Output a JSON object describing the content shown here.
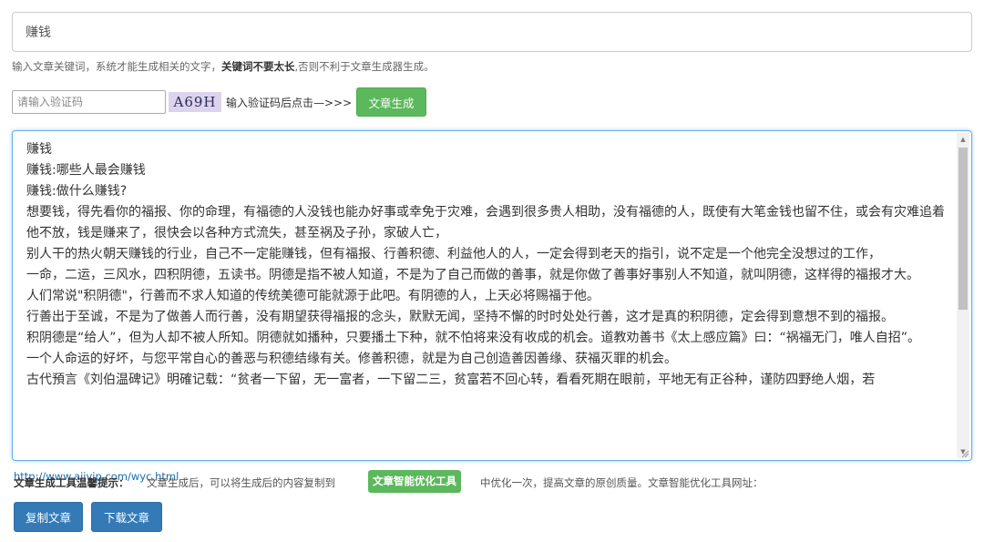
{
  "keyword": {
    "value": "赚钱"
  },
  "hint": {
    "prefix": "输入文章关键词，系统才能生成相关的文字，",
    "bold": "关键词不要太长",
    "suffix": ",否则不利于文章生成器生成。"
  },
  "captcha": {
    "placeholder": "请输入验证码",
    "code": "A69H",
    "instruction": "输入验证码后点击—>>>",
    "generate_label": "文章生成"
  },
  "article": {
    "lines": [
      "赚钱",
      "赚钱:哪些人最会赚钱",
      "赚钱:做什么赚钱?",
      "想要钱，得先看你的福报、你的命理，有福德的人没钱也能办好事或幸免于灾难，会遇到很多贵人相助，没有福德的人，既使有大笔金钱也留不住，或会有灾难追着他不放，钱是赚来了，很快会以各种方式流失，甚至祸及子孙，家破人亡，",
      "别人干的热火朝天赚钱的行业，自己不一定能赚钱，但有福报、行善积德、利益他人的人，一定会得到老天的指引，说不定是一个他完全没想过的工作，",
      "一命，二运，三风水，四积阴德，五读书。阴德是指不被人知道，不是为了自己而做的善事，就是你做了善事好事别人不知道，就叫阴德，这样得的福报才大。",
      "人们常说\"积阴德\"，行善而不求人知道的传统美德可能就源于此吧。有阴德的人，上天必将赐福于他。",
      "行善出于至诚，不是为了做善人而行善，没有期望获得福报的念头，默默无闻，坚持不懈的时时处处行善，这才是真的积阴德，定会得到意想不到的福报。",
      "积阴德是“给人”，但为人却不被人所知。阴德就如播种，只要播土下种，就不怕将来没有收成的机会。道教劝善书《太上感应篇》曰：“祸福无门，唯人自招”。",
      "一个人命运的好坏，与您平常自心的善恶与积德结缘有关。修善积德，就是为自己创造善因善缘、获福灭罪的机会。",
      "古代預言《刘伯温碑记》明確记载：“贫者一下留，无一富者，一下留二三，贫富若不回心转，看看死期在眼前，平地无有正谷种，谨防四野绝人烟，若"
    ]
  },
  "tip": {
    "label": "文章生成工具温馨提示：",
    "text1": "文章生成后，可以将生成后的内容复制到",
    "tool_name": "文章智能优化工具",
    "text2": "中优化一次，提高文章的原创质量。文章智能优化工具网址：",
    "url": "http://www.aiivip.com/wyc.html"
  },
  "buttons": {
    "copy_label": "复制文章",
    "download_label": "下载文章"
  },
  "colors": {
    "green": "#5cb85c",
    "blue": "#337ab7",
    "focus_border": "#66afe9",
    "link": "#1a6dad"
  }
}
